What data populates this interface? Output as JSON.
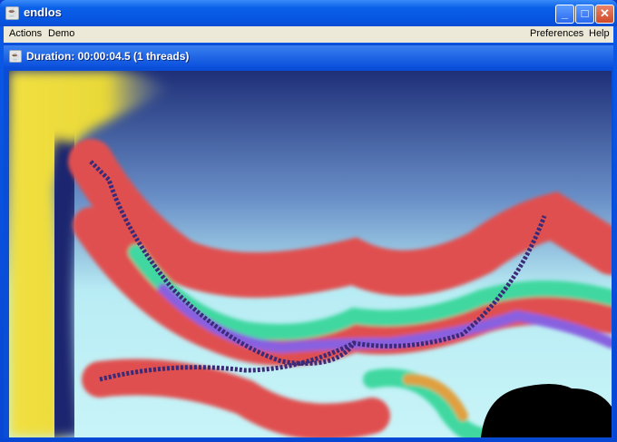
{
  "window": {
    "title": "endlos",
    "minimize": "_",
    "maximize": "□",
    "close": "✕"
  },
  "menubar": {
    "left": [
      "Actions",
      "Demo"
    ],
    "right": [
      "Preferences",
      "Help"
    ]
  },
  "internal_frame": {
    "title": "Duration: 00:00:04.5 (1 threads)"
  }
}
